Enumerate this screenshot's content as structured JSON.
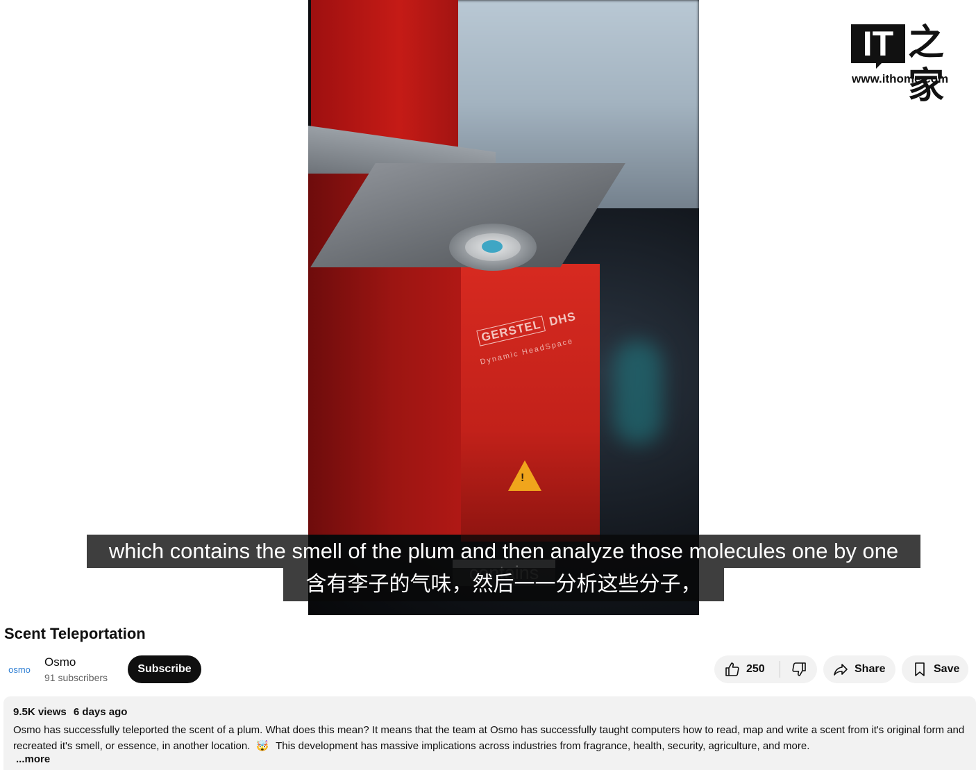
{
  "video": {
    "product_brand": "GERSTEL",
    "product_model": "DHS",
    "product_subtitle": "Dynamic HeadSpace",
    "captions": {
      "english": "which contains the smell of the plum and then analyze those molecules one by one",
      "chinese": "含有李子的气味，然后一一分析这些分子，",
      "ghost": "contains"
    }
  },
  "watermark": {
    "logo_text": "IT",
    "han_text": "之家",
    "url": "www.ithome.com"
  },
  "title": "Scent Teleportation",
  "channel": {
    "avatar_text": "osmo",
    "name": "Osmo",
    "subscribers": "91 subscribers"
  },
  "actions": {
    "subscribe_label": "Subscribe",
    "like_count": "250",
    "share_label": "Share",
    "save_label": "Save"
  },
  "description": {
    "views": "9.5K views",
    "age": "6 days ago",
    "text_part1": "Osmo has successfully teleported the scent of a plum. What does this mean? It means that the team at Osmo has successfully taught computers how to read, map and write a scent from it's original form and recreated it's smell, or essence, in another location.",
    "emoji": "🤯",
    "text_part2": "This development has massive implications across industries from fragrance, health, security, agriculture, and more.",
    "more_label": "...more"
  },
  "colors": {
    "caption_bg": "#080808",
    "subscribe_bg": "#0f0f0f",
    "pill_bg": "#f2f2f2",
    "avatar_text": "#2f7fd3",
    "device_red": "#c51b16"
  }
}
